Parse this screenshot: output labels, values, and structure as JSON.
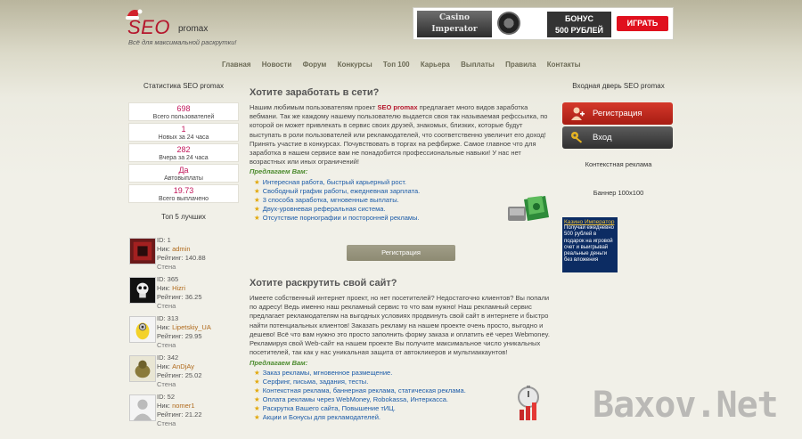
{
  "header": {
    "logo_seo": "SEO",
    "logo_promax": "promax",
    "tagline": "Всё для максимальной раскрутки!",
    "banner": {
      "casino_line1": "Casino",
      "casino_line2": "Imperator",
      "bonus_line1": "БОНУС",
      "bonus_line2": "500 РУБЛЕЙ",
      "play_label": "ИГРАТЬ"
    }
  },
  "nav": [
    "Главная",
    "Новости",
    "Форум",
    "Конкурсы",
    "Топ 100",
    "Карьера",
    "Выплаты",
    "Правила",
    "Контакты"
  ],
  "left": {
    "stats_title": "Статистика SEO promax",
    "stats": [
      {
        "value": "698",
        "label": "Всего пользователей"
      },
      {
        "value": "1",
        "label": "Новых за 24 часа"
      },
      {
        "value": "282",
        "label": "Вчера за 24 часа"
      },
      {
        "value": "Да",
        "label": "Автовыплаты"
      },
      {
        "value": "19.73",
        "label": "Всего выплачено"
      }
    ],
    "top_title": "Топ 5 лучших",
    "users": [
      {
        "id": "ID: 1",
        "nick_label": "Ник:",
        "nick": "admin",
        "rating_label": "Рейтинг:",
        "rating": "140.88",
        "wall": "Стена"
      },
      {
        "id": "ID: 365",
        "nick_label": "Ник:",
        "nick": "Hizri",
        "rating_label": "Рейтинг:",
        "rating": "36.25",
        "wall": "Стена"
      },
      {
        "id": "ID: 313",
        "nick_label": "Ник:",
        "nick": "Lipetskiy_UA",
        "rating_label": "Рейтинг:",
        "rating": "29.95",
        "wall": "Стена"
      },
      {
        "id": "ID: 342",
        "nick_label": "Ник:",
        "nick": "AnDjAy",
        "rating_label": "Рейтинг:",
        "rating": "25.02",
        "wall": "Стена"
      },
      {
        "id": "ID: 52",
        "nick_label": "Ник:",
        "nick": "nomer1",
        "rating_label": "Рейтинг:",
        "rating": "21.22",
        "wall": "Стена"
      }
    ]
  },
  "main": {
    "earn_title": "Хотите заработать в сети?",
    "earn_text_pre": "Нашим любимым пользователям проект ",
    "earn_text_brand": "SEO promax",
    "earn_text_post": " предлагает много видов заработка вебмани. Так же каждому нашему пользователю выдается своя так называемая рефссылка, по которой он может привлекать в сервис своих друзей, знакомых, близких, которые будут выступать в роли пользователей или рекламодателей, что соответственно увеличит его доход! Принять участие в конкурсах. Почувствовать в торгах на рефбирже. Самое главное что для заработка в нашем сервисе вам не понадобится профессиональные навыки! У нас нет возрастных или иных ограничений!",
    "offer_title": "Предлагаем Вам:",
    "earn_list": [
      "Интересная работа, быстрый карьерный рост.",
      "Свободный график работы, ежедневная зарплата.",
      "3 способа заработка, мгновенные выплаты.",
      "Двух-уровневая реферальная система.",
      "Отсутствие порнографии и посторонней рекламы."
    ],
    "register_label": "Регистрация",
    "promo_title": "Хотите раскрутить свой сайт?",
    "promo_text": "Имеете собственный интернет проект, но нет посетителей? Недостаточно клиентов? Вы попали по адресу! Ведь именно наш рекламный сервис то что вам нужно! Наш рекламный сервис предлагает рекламодателям на выгодных условиях продвинуть свой сайт в интернете и быстро найти потенциальных клиентов! Заказать рекламу на нашем проекте очень просто, выгодно и дешево! Всё что вам нужно это просто заполнить форму заказа и оплатить её через Webmoney. Рекламируя свой Web-сайт на нашем проекте Вы получите максимальное число уникальных посетителей, так как у нас уникальная защита от автокликеров и мультиаккаунтов!",
    "promo_offer_title": "Предлагаем Вам:",
    "promo_list": [
      "Заказ рекламы, мгновенное размещение.",
      "Серфинг, письма, задания, тесты.",
      "Контекстная реклама, баннерная реклама, статическая реклама.",
      "Оплата рекламы через WebMoney, Robokassa, Интеркасса.",
      "Раскрутка Вашего сайта, Повышение тИЦ.",
      "Акции и Бонусы для рекламодателей."
    ]
  },
  "right": {
    "title": "Входная дверь SEO promax",
    "register_label": "Регистрация",
    "login_label": "Вход",
    "context_label": "Контекстная реклама",
    "banner_label": "Баннер 100x100",
    "ad_title": "Казино Император",
    "ad_text": "Получай ежедневно 500 рублей в подарок на игровой счет и выигрывай реальные деньги без вложения"
  },
  "watermark": "Baxov.Net",
  "colors": {
    "accent": "#b5172d",
    "link": "#1b5ba8",
    "green": "#4a8a2c",
    "value": "#c2185b"
  }
}
